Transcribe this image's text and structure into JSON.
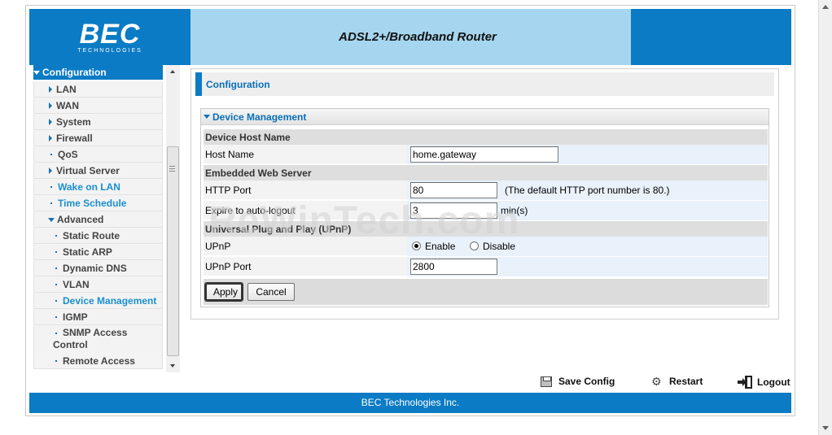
{
  "header": {
    "logo_main": "BEC",
    "logo_sub": "TECHNOLOGIES",
    "title": "ADSL2+/Broadband Router"
  },
  "sidebar": {
    "section": "Configuration",
    "items": [
      {
        "label": "LAN"
      },
      {
        "label": "WAN"
      },
      {
        "label": "System"
      },
      {
        "label": "Firewall"
      },
      {
        "label": "QoS"
      },
      {
        "label": "Virtual Server"
      },
      {
        "label": "Wake on LAN"
      },
      {
        "label": "Time Schedule"
      },
      {
        "label": "Advanced"
      }
    ],
    "sub_items": [
      {
        "label": "Static Route"
      },
      {
        "label": "Static ARP"
      },
      {
        "label": "Dynamic DNS"
      },
      {
        "label": "VLAN"
      },
      {
        "label": "Device Management"
      },
      {
        "label": "IGMP"
      },
      {
        "label": "SNMP Access"
      },
      {
        "label": "Remote Access"
      }
    ],
    "snmp_line2": "Control"
  },
  "page": {
    "title": "Configuration",
    "panel_title": "Device Management"
  },
  "form": {
    "sec_host": "Device Host Name",
    "host_label": "Host Name",
    "host_value": "home.gateway",
    "sec_web": "Embedded Web Server",
    "http_label": "HTTP Port",
    "http_value": "80",
    "http_note": "(The default HTTP port number is 80.)",
    "expire_label": "Expire to auto-logout",
    "expire_value": "3",
    "expire_unit": "min(s)",
    "sec_upnp": "Universal Plug and Play (UPnP)",
    "upnp_label": "UPnP",
    "upnp_enable": "Enable",
    "upnp_disable": "Disable",
    "upnp_port_label": "UPnP Port",
    "upnp_port_value": "2800",
    "apply": "Apply",
    "cancel": "Cancel"
  },
  "watermark": "ReWinTech.com",
  "actions": {
    "save": "Save Config",
    "restart": "Restart",
    "logout": "Logout"
  },
  "footer": "BEC Technologies Inc.",
  "colors": {
    "brand_blue": "#0a7bc4",
    "header_light": "#a6d6ef",
    "link_blue": "#1a8fd0"
  }
}
